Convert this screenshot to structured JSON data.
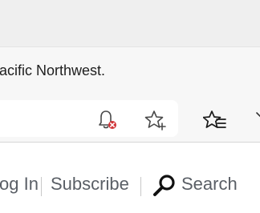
{
  "notice": {
    "text": "acific Northwest."
  },
  "toolbar": {
    "icons": {
      "notifications": "bell-blocked-icon",
      "add_favorite": "star-plus-icon",
      "favorites": "favorites-list-icon"
    },
    "colors": {
      "blocked_badge": "#d13438"
    }
  },
  "site_nav": {
    "login_label": "og In",
    "subscribe_label": "Subscribe",
    "search_label": "Search",
    "search_icon": "magnifier-icon"
  }
}
